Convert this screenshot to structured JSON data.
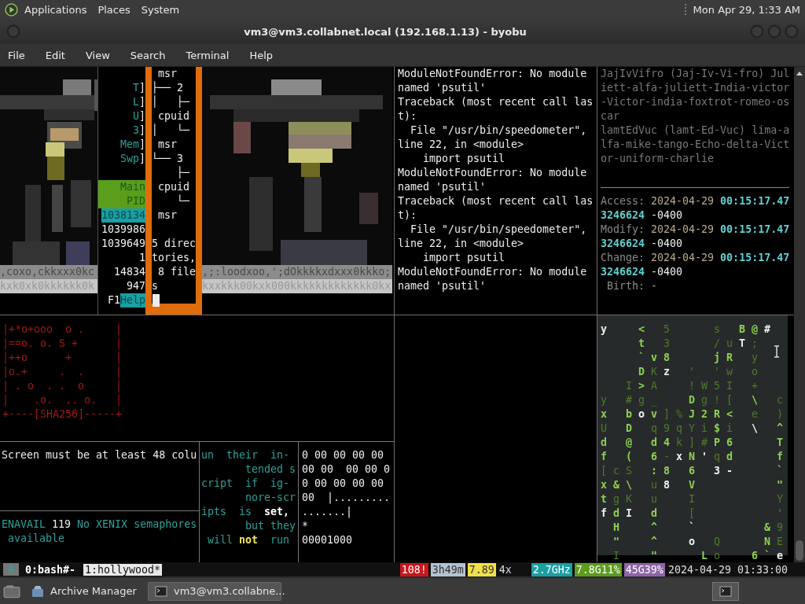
{
  "top_panel": {
    "menus": [
      "Applications",
      "Places",
      "System"
    ],
    "clock": "Mon Apr 29, 1:33 AM"
  },
  "window": {
    "title": "vm3@vm3.collabnet.local (192.168.1.13) - byobu",
    "menu": [
      "File",
      "Edit",
      "View",
      "Search",
      "Terminal",
      "Help"
    ]
  },
  "art_left": {
    "kind": "picture",
    "lines": [
      ",coxo,ckkxxx0kc",
      "kxk0xk0kkkkkk0k"
    ]
  },
  "htop": [
    {
      "kind": "blank"
    },
    {
      "kind": "meter",
      "label": "T",
      "bracket": "]"
    },
    {
      "kind": "meter",
      "label": "L",
      "bracket": "]"
    },
    {
      "kind": "meter",
      "label": "U",
      "bracket": "]"
    },
    {
      "kind": "meter",
      "label": "3",
      "bracket": "]"
    },
    {
      "kind": "meter",
      "label": "Mem",
      "bracket": "]"
    },
    {
      "kind": "meter",
      "label": "Swp",
      "bracket": "]"
    },
    {
      "kind": "blank"
    },
    {
      "kind": "header",
      "text": "Main"
    },
    {
      "kind": "header",
      "text": "PID"
    },
    {
      "kind": "selected",
      "text": "1038134"
    },
    {
      "kind": "plain",
      "text": "1039986"
    },
    {
      "kind": "plain",
      "text": "1039649"
    },
    {
      "kind": "plain",
      "text": "1"
    },
    {
      "kind": "plain",
      "text": "14834"
    },
    {
      "kind": "plain",
      "text": "947"
    },
    {
      "kind": "key",
      "key": "F1",
      "label": "Help"
    }
  ],
  "tree": {
    "lines": [
      " msr",
      "├── 2",
      "│   ├─",
      " cpuid",
      "│   └─",
      " msr",
      "└── 3",
      "    ├─",
      " cpuid",
      "    └─",
      " msr"
    ],
    "listing": [
      "5 direc",
      "tories,",
      " 8 file",
      "s"
    ]
  },
  "art_right": {
    "kind": "picture",
    "lines": [
      ",;:loodxoo,';dOkkkkxdxxx0kkko;",
      "kxxkkk00kxk000kkkkkkkkkkkkk0kx"
    ]
  },
  "traceback": [
    "ModuleNotFoundError: No module",
    "named 'psutil'",
    "Traceback (most recent call las",
    "t):",
    "  File \"/usr/bin/speedometer\",",
    "line 22, in <module>",
    "    import psutil",
    "ModuleNotFoundError: No module",
    "named 'psutil'",
    "Traceback (most recent call las",
    "t):",
    "  File \"/usr/bin/speedometer\",",
    "line 22, in <module>",
    "    import psutil",
    "ModuleNotFoundError: No module",
    "named 'psutil'"
  ],
  "glossary": [
    "JajIvVifro (Jaj-Iv-Vi-fro) Jul",
    "iett-alfa-juliett-India-victor",
    "-Victor-india-foxtrot-romeo-os",
    "car",
    "lamtEdVuc (lamt-Ed-Vuc) lima-a",
    "lfa-mike-tango-Echo-delta-Vict",
    "or-uniform-charlie"
  ],
  "stat": [
    [
      {
        "text": "Access: ",
        "kind": "label"
      },
      {
        "text": "2024-04-29 ",
        "kind": "date"
      },
      {
        "text": "00:15:17.47",
        "kind": "time"
      }
    ],
    [
      {
        "text": "3246624",
        "kind": "time"
      },
      {
        "text": " -0400",
        "kind": "plain"
      }
    ],
    [
      {
        "text": "Modify: ",
        "kind": "label"
      },
      {
        "text": "2024-04-29 ",
        "kind": "date"
      },
      {
        "text": "00:15:17.47",
        "kind": "time"
      }
    ],
    [
      {
        "text": "3246624",
        "kind": "time"
      },
      {
        "text": " -0400",
        "kind": "plain"
      }
    ],
    [
      {
        "text": "Change: ",
        "kind": "label"
      },
      {
        "text": "2024-04-29 ",
        "kind": "date"
      },
      {
        "text": "00:15:17.47",
        "kind": "time"
      }
    ],
    [
      {
        "text": "3246624",
        "kind": "time"
      },
      {
        "text": " -0400",
        "kind": "plain"
      }
    ],
    [
      {
        "text": " Birth: ",
        "kind": "label"
      },
      {
        "text": "-",
        "kind": "date"
      }
    ]
  ],
  "randomart": [
    "|+*o+ooo  o .     |",
    "|==o. o. S +      |",
    "|++o      +       |",
    "|o.+     .  .     |",
    "| . o  . .  o     |",
    "|    .o.  .. o.   |",
    "+----[SHA256]-----+"
  ],
  "screen_msg": "Screen must be at least 48 colu",
  "errno": [
    [
      {
        "text": "ENAVAIL ",
        "kind": "teal"
      },
      {
        "text": "119",
        "kind": "plain"
      },
      {
        "text": " No XENIX semaphores",
        "kind": "teal"
      }
    ],
    [
      {
        "text": " available",
        "kind": "teal"
      }
    ]
  ],
  "manpage": [
    [
      {
        "text": "un  their  in-",
        "kind": "teal"
      }
    ],
    [
      {
        "text": "       tended s",
        "kind": "teal"
      }
    ],
    [
      {
        "text": "cript  if  ig-",
        "kind": "teal"
      }
    ],
    [
      {
        "text": "       nore-scr",
        "kind": "teal"
      }
    ],
    [
      {
        "text": "ipts  is  ",
        "kind": "teal"
      },
      {
        "text": "set,",
        "kind": "bold"
      }
    ],
    [
      {
        "text": "       but they",
        "kind": "teal"
      }
    ],
    [
      {
        "text": " will ",
        "kind": "teal"
      },
      {
        "text": "not",
        "kind": "yellow"
      },
      {
        "text": "  run",
        "kind": "teal"
      }
    ]
  ],
  "hexdump": [
    "0 00 00 00 00",
    "00 00  00 00 0",
    "0 00 00 00 00",
    "00  |.........",
    ".......|",
    "*",
    "00001000"
  ],
  "matrix": [
    [
      {
        "text": "y",
        "kind": "white"
      },
      {
        "kind": "gap"
      },
      {
        "kind": "gap"
      },
      {
        "text": "<",
        "kind": "green"
      },
      {
        "kind": "gap"
      },
      {
        "text": "5",
        "kind": "dim"
      },
      {
        "kind": "gap"
      },
      {
        "kind": "gap"
      },
      {
        "kind": "gap"
      },
      {
        "text": "s",
        "kind": "dim"
      },
      {
        "kind": "gap"
      },
      {
        "text": "B",
        "kind": "green"
      },
      {
        "text": "@",
        "kind": "green"
      },
      {
        "text": "#",
        "kind": "white"
      }
    ],
    [
      {
        "kind": "gap"
      },
      {
        "kind": "gap"
      },
      {
        "kind": "gap"
      },
      {
        "text": "t",
        "kind": "green"
      },
      {
        "kind": "gap"
      },
      {
        "text": "3",
        "kind": "dim"
      },
      {
        "kind": "gap"
      },
      {
        "kind": "gap"
      },
      {
        "kind": "gap"
      },
      {
        "text": "/",
        "kind": "dim"
      },
      {
        "text": "u",
        "kind": "dim"
      },
      {
        "text": "T",
        "kind": "white"
      },
      {
        "text": ";",
        "kind": "dim"
      }
    ],
    [
      {
        "kind": "gap"
      },
      {
        "kind": "gap"
      },
      {
        "kind": "gap"
      },
      {
        "text": "`",
        "kind": "green"
      },
      {
        "text": "v",
        "kind": "green"
      },
      {
        "text": "8",
        "kind": "green"
      },
      {
        "kind": "gap"
      },
      {
        "kind": "gap"
      },
      {
        "kind": "gap"
      },
      {
        "text": "j",
        "kind": "green"
      },
      {
        "text": "R",
        "kind": "green"
      },
      {
        "kind": "gap"
      },
      {
        "text": "y",
        "kind": "dim"
      }
    ],
    [
      {
        "kind": "gap"
      },
      {
        "kind": "gap"
      },
      {
        "kind": "gap"
      },
      {
        "text": "D",
        "kind": "green"
      },
      {
        "text": "K",
        "kind": "dim"
      },
      {
        "text": "z",
        "kind": "white"
      },
      {
        "kind": "gap"
      },
      {
        "text": "'",
        "kind": "dim"
      },
      {
        "kind": "gap"
      },
      {
        "text": "'",
        "kind": "dim"
      },
      {
        "text": "w",
        "kind": "dim"
      },
      {
        "kind": "gap"
      },
      {
        "text": "o",
        "kind": "dim"
      }
    ],
    [
      {
        "kind": "gap"
      },
      {
        "kind": "gap"
      },
      {
        "text": "I",
        "kind": "dim"
      },
      {
        "text": ">",
        "kind": "green"
      },
      {
        "text": "A",
        "kind": "dim"
      },
      {
        "kind": "gap"
      },
      {
        "kind": "gap"
      },
      {
        "text": "!",
        "kind": "dim"
      },
      {
        "text": "W",
        "kind": "dim"
      },
      {
        "text": "5",
        "kind": "dim"
      },
      {
        "text": "I",
        "kind": "dim"
      },
      {
        "kind": "gap"
      },
      {
        "text": "+",
        "kind": "dim"
      }
    ],
    [
      {
        "text": "y",
        "kind": "dim"
      },
      {
        "kind": "gap"
      },
      {
        "text": "#",
        "kind": "dim"
      },
      {
        "text": "g",
        "kind": "dim"
      },
      {
        "text": "_",
        "kind": "dim"
      },
      {
        "kind": "gap"
      },
      {
        "kind": "gap"
      },
      {
        "text": "D",
        "kind": "green"
      },
      {
        "text": "g",
        "kind": "dim"
      },
      {
        "text": "!",
        "kind": "dim"
      },
      {
        "text": "[",
        "kind": "dim"
      },
      {
        "kind": "gap"
      },
      {
        "text": "\\",
        "kind": "green"
      },
      {
        "kind": "gap"
      },
      {
        "text": "c",
        "kind": "dim"
      }
    ],
    [
      {
        "text": "x",
        "kind": "green"
      },
      {
        "kind": "gap"
      },
      {
        "text": "b",
        "kind": "green"
      },
      {
        "text": "o",
        "kind": "white"
      },
      {
        "text": "v",
        "kind": "green"
      },
      {
        "text": "]",
        "kind": "dim"
      },
      {
        "text": "%",
        "kind": "dim"
      },
      {
        "text": "J",
        "kind": "green"
      },
      {
        "text": "2",
        "kind": "green"
      },
      {
        "text": "R",
        "kind": "green"
      },
      {
        "text": "<",
        "kind": "green"
      },
      {
        "kind": "gap"
      },
      {
        "text": "e",
        "kind": "dim"
      },
      {
        "kind": "gap"
      },
      {
        "text": ")",
        "kind": "dim"
      }
    ],
    [
      {
        "text": "U",
        "kind": "dim"
      },
      {
        "kind": "gap"
      },
      {
        "text": "D",
        "kind": "green"
      },
      {
        "kind": "gap"
      },
      {
        "text": "q",
        "kind": "dim"
      },
      {
        "text": "9",
        "kind": "dim"
      },
      {
        "text": "q",
        "kind": "dim"
      },
      {
        "text": "Y",
        "kind": "dim"
      },
      {
        "text": "i",
        "kind": "dim"
      },
      {
        "text": "$",
        "kind": "green"
      },
      {
        "text": "i",
        "kind": "dim"
      },
      {
        "kind": "gap"
      },
      {
        "text": "\\",
        "kind": "white"
      },
      {
        "kind": "gap"
      },
      {
        "text": "^",
        "kind": "green"
      }
    ],
    [
      {
        "text": "d",
        "kind": "green"
      },
      {
        "kind": "gap"
      },
      {
        "text": "@",
        "kind": "green"
      },
      {
        "kind": "gap"
      },
      {
        "text": "d",
        "kind": "green"
      },
      {
        "text": "4",
        "kind": "green"
      },
      {
        "text": "k",
        "kind": "dim"
      },
      {
        "text": "]",
        "kind": "dim"
      },
      {
        "text": "#",
        "kind": "dim"
      },
      {
        "text": "P",
        "kind": "green"
      },
      {
        "text": "6",
        "kind": "green"
      },
      {
        "kind": "gap"
      },
      {
        "kind": "gap"
      },
      {
        "kind": "gap"
      },
      {
        "text": "T",
        "kind": "green"
      }
    ],
    [
      {
        "text": "f",
        "kind": "green"
      },
      {
        "kind": "gap"
      },
      {
        "text": "(",
        "kind": "green"
      },
      {
        "kind": "gap"
      },
      {
        "text": "6",
        "kind": "green"
      },
      {
        "text": "-",
        "kind": "dim"
      },
      {
        "text": "x",
        "kind": "white"
      },
      {
        "text": "N",
        "kind": "green"
      },
      {
        "text": "'",
        "kind": "white"
      },
      {
        "text": "q",
        "kind": "dim"
      },
      {
        "text": "d",
        "kind": "green"
      },
      {
        "kind": "gap"
      },
      {
        "kind": "gap"
      },
      {
        "kind": "gap"
      },
      {
        "text": "f",
        "kind": "green"
      }
    ],
    [
      {
        "text": "[",
        "kind": "dim"
      },
      {
        "text": "c",
        "kind": "dim"
      },
      {
        "text": "S",
        "kind": "dim"
      },
      {
        "kind": "gap"
      },
      {
        "text": ":",
        "kind": "green"
      },
      {
        "text": "8",
        "kind": "green"
      },
      {
        "kind": "gap"
      },
      {
        "text": "6",
        "kind": "green"
      },
      {
        "kind": "gap"
      },
      {
        "text": "3",
        "kind": "white"
      },
      {
        "text": "-",
        "kind": "white"
      },
      {
        "kind": "gap"
      },
      {
        "kind": "gap"
      },
      {
        "kind": "gap"
      },
      {
        "text": "`",
        "kind": "green"
      }
    ],
    [
      {
        "text": "x",
        "kind": "green"
      },
      {
        "text": "&",
        "kind": "green"
      },
      {
        "text": "\\",
        "kind": "green"
      },
      {
        "kind": "gap"
      },
      {
        "text": "u",
        "kind": "dim"
      },
      {
        "text": "8",
        "kind": "white"
      },
      {
        "kind": "gap"
      },
      {
        "text": "V",
        "kind": "green"
      },
      {
        "kind": "gap"
      },
      {
        "kind": "gap"
      },
      {
        "kind": "gap"
      },
      {
        "kind": "gap"
      },
      {
        "kind": "gap"
      },
      {
        "kind": "gap"
      },
      {
        "text": "\"",
        "kind": "green"
      }
    ],
    [
      {
        "text": "t",
        "kind": "green"
      },
      {
        "text": "g",
        "kind": "dim"
      },
      {
        "text": "K",
        "kind": "dim"
      },
      {
        "kind": "gap"
      },
      {
        "text": "u",
        "kind": "dim"
      },
      {
        "kind": "gap"
      },
      {
        "kind": "gap"
      },
      {
        "text": "I",
        "kind": "dim"
      },
      {
        "kind": "gap"
      },
      {
        "kind": "gap"
      },
      {
        "kind": "gap"
      },
      {
        "kind": "gap"
      },
      {
        "kind": "gap"
      },
      {
        "kind": "gap"
      },
      {
        "text": "Y",
        "kind": "dim"
      }
    ],
    [
      {
        "text": "f",
        "kind": "white"
      },
      {
        "text": "d",
        "kind": "green"
      },
      {
        "text": "I",
        "kind": "white"
      },
      {
        "kind": "gap"
      },
      {
        "text": "d",
        "kind": "green"
      },
      {
        "kind": "gap"
      },
      {
        "kind": "gap"
      },
      {
        "text": "[",
        "kind": "dim"
      },
      {
        "kind": "gap"
      },
      {
        "kind": "gap"
      },
      {
        "kind": "gap"
      },
      {
        "kind": "gap"
      },
      {
        "kind": "gap"
      },
      {
        "kind": "gap"
      },
      {
        "text": "'",
        "kind": "dim"
      }
    ],
    [
      {
        "kind": "gap"
      },
      {
        "text": "H",
        "kind": "green"
      },
      {
        "kind": "gap"
      },
      {
        "kind": "gap"
      },
      {
        "text": "^",
        "kind": "green"
      },
      {
        "kind": "gap"
      },
      {
        "kind": "gap"
      },
      {
        "text": "`",
        "kind": "white"
      },
      {
        "kind": "gap"
      },
      {
        "kind": "gap"
      },
      {
        "kind": "gap"
      },
      {
        "kind": "gap"
      },
      {
        "kind": "gap"
      },
      {
        "text": "&",
        "kind": "green"
      },
      {
        "text": "9",
        "kind": "dim"
      }
    ],
    [
      {
        "kind": "gap"
      },
      {
        "text": "\"",
        "kind": "green"
      },
      {
        "kind": "gap"
      },
      {
        "kind": "gap"
      },
      {
        "text": "^",
        "kind": "green"
      },
      {
        "kind": "gap"
      },
      {
        "kind": "gap"
      },
      {
        "text": "o",
        "kind": "white"
      },
      {
        "kind": "gap"
      },
      {
        "text": "Q",
        "kind": "dim"
      },
      {
        "kind": "gap"
      },
      {
        "kind": "gap"
      },
      {
        "kind": "gap"
      },
      {
        "text": "N",
        "kind": "green"
      },
      {
        "text": "E",
        "kind": "dim"
      }
    ],
    [
      {
        "kind": "gap"
      },
      {
        "text": "I",
        "kind": "dim"
      },
      {
        "kind": "gap"
      },
      {
        "kind": "gap"
      },
      {
        "text": "\"",
        "kind": "green"
      },
      {
        "kind": "gap"
      },
      {
        "kind": "gap"
      },
      {
        "kind": "gap"
      },
      {
        "text": "L",
        "kind": "green"
      },
      {
        "text": "o",
        "kind": "dim"
      },
      {
        "kind": "gap"
      },
      {
        "kind": "gap"
      },
      {
        "text": "6",
        "kind": "green"
      },
      {
        "text": "`",
        "kind": "green"
      },
      {
        "text": "e",
        "kind": "white"
      }
    ]
  ],
  "status_bar": {
    "session": "A",
    "windows": [
      {
        "label": "0:bash#-",
        "selected": false
      },
      {
        "label": "1:hollywood*",
        "selected": true
      }
    ],
    "items": [
      {
        "kind": "badge",
        "text": "108!",
        "color": "#c8161d"
      },
      {
        "kind": "badge",
        "text": "3h49m",
        "color": "#b4c3d0"
      },
      {
        "kind": "badge",
        "text": "7.89",
        "color": "#f0e04a"
      },
      {
        "kind": "plain",
        "text": "4x"
      },
      {
        "kind": "badge",
        "text": "2.7GHz",
        "color": "#1a9fa3"
      },
      {
        "kind": "badge",
        "text": "7.8G11%",
        "color": "#5c9c1c"
      },
      {
        "kind": "badge",
        "text": "45G39%",
        "color": "#8f64a8"
      },
      {
        "kind": "plain",
        "text": "2024-04-29 01:33:00"
      }
    ]
  },
  "taskbar": {
    "tasks": [
      {
        "label": "Archive Manager",
        "selected": false
      },
      {
        "label": "vm3@vm3.collabne...",
        "selected": true
      }
    ]
  }
}
